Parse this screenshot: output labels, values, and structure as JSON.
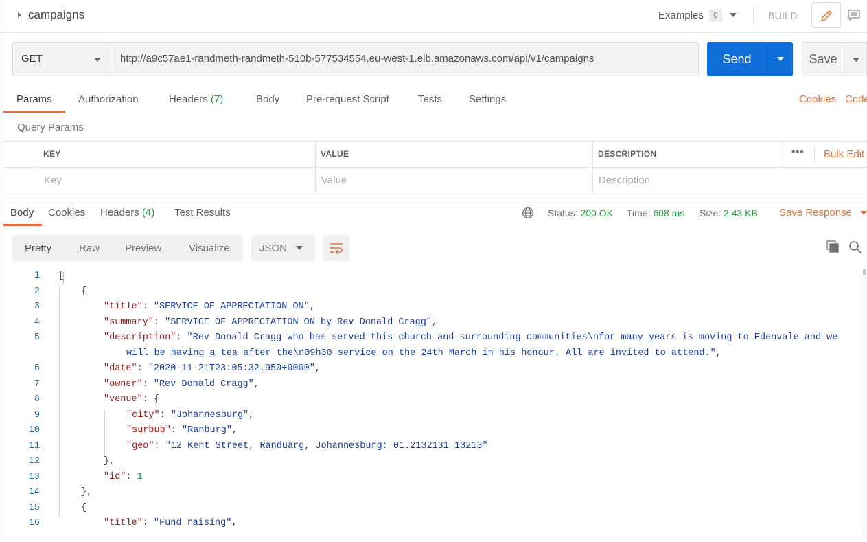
{
  "header": {
    "collection_name": "campaigns",
    "examples_label": "Examples",
    "examples_count": "0",
    "build_label": "BUILD",
    "icons": [
      "caret-right-icon",
      "chevron-down-icon",
      "pencil-icon",
      "comment-icon"
    ]
  },
  "request": {
    "method": "GET",
    "url": "http://a9c57ae1-randmeth-randmeth-510b-577534554.eu-west-1.elb.amazonaws.com/api/v1/campaigns",
    "send_label": "Send",
    "save_label": "Save"
  },
  "request_tabs": {
    "params": "Params",
    "authorization": "Authorization",
    "headers": "Headers",
    "headers_count": "(7)",
    "body": "Body",
    "prerequest": "Pre-request Script",
    "tests": "Tests",
    "settings": "Settings",
    "cookies": "Cookies",
    "code": "Code"
  },
  "query_params": {
    "label": "Query Params",
    "columns": [
      "KEY",
      "VALUE",
      "DESCRIPTION"
    ],
    "placeholders": [
      "Key",
      "Value",
      "Description"
    ],
    "more": "•••",
    "bulk_edit": "Bulk Edit"
  },
  "response": {
    "tabs": {
      "body": "Body",
      "cookies": "Cookies",
      "headers": "Headers",
      "headers_count": "(4)",
      "test_results": "Test Results"
    },
    "status_label": "Status:",
    "status_value": "200 OK",
    "time_label": "Time:",
    "time_value": "608 ms",
    "size_label": "Size:",
    "size_value": "2.43 KB",
    "save_response": "Save Response",
    "view_modes": [
      "Pretty",
      "Raw",
      "Preview",
      "Visualize"
    ],
    "format": "JSON",
    "colors": {
      "accent": "#f26b3a",
      "send": "#0f6fd9",
      "ok": "#2a9d44"
    }
  },
  "code_lines": [
    {
      "n": "1",
      "indent": 0,
      "t": [
        [
          "p",
          "["
        ]
      ]
    },
    {
      "n": "2",
      "indent": 1,
      "t": [
        [
          "p",
          "{"
        ]
      ]
    },
    {
      "n": "3",
      "indent": 2,
      "t": [
        [
          "k",
          "\"title\""
        ],
        [
          "p",
          ": "
        ],
        [
          "s",
          "\"SERVICE OF APPRECIATION ON\""
        ],
        [
          "p",
          ","
        ]
      ]
    },
    {
      "n": "4",
      "indent": 2,
      "t": [
        [
          "k",
          "\"summary\""
        ],
        [
          "p",
          ": "
        ],
        [
          "s",
          "\"SERVICE OF APPRECIATION ON by Rev Donald Cragg\""
        ],
        [
          "p",
          ","
        ]
      ]
    },
    {
      "n": "5",
      "indent": 2,
      "t": [
        [
          "k",
          "\"description\""
        ],
        [
          "p",
          ": "
        ],
        [
          "s",
          "\"Rev Donald Cragg who has served this church and surrounding communities\\nfor many years is moving to Edenvale and we"
        ]
      ]
    },
    {
      "n": "",
      "indent": 3,
      "t": [
        [
          "s",
          "will be having a tea after the\\n09h30 service on the 24th March in his honour. All are invited to attend.\""
        ],
        [
          "p",
          ","
        ]
      ]
    },
    {
      "n": "6",
      "indent": 2,
      "t": [
        [
          "k",
          "\"date\""
        ],
        [
          "p",
          ": "
        ],
        [
          "s",
          "\"2020-11-21T23:05:32.950+0000\""
        ],
        [
          "p",
          ","
        ]
      ]
    },
    {
      "n": "7",
      "indent": 2,
      "t": [
        [
          "k",
          "\"owner\""
        ],
        [
          "p",
          ": "
        ],
        [
          "s",
          "\"Rev Donald Cragg\""
        ],
        [
          "p",
          ","
        ]
      ]
    },
    {
      "n": "8",
      "indent": 2,
      "t": [
        [
          "k",
          "\"venue\""
        ],
        [
          "p",
          ": {"
        ]
      ]
    },
    {
      "n": "9",
      "indent": 3,
      "t": [
        [
          "k",
          "\"city\""
        ],
        [
          "p",
          ": "
        ],
        [
          "s",
          "\"Johannesburg\""
        ],
        [
          "p",
          ","
        ]
      ]
    },
    {
      "n": "10",
      "indent": 3,
      "t": [
        [
          "k",
          "\"surbub\""
        ],
        [
          "p",
          ": "
        ],
        [
          "s",
          "\"Ranburg\""
        ],
        [
          "p",
          ","
        ]
      ]
    },
    {
      "n": "11",
      "indent": 3,
      "t": [
        [
          "k",
          "\"geo\""
        ],
        [
          "p",
          ": "
        ],
        [
          "s",
          "\"12 Kent Street, Randuarg, Johannesburg: 01.2132131 13213\""
        ]
      ]
    },
    {
      "n": "12",
      "indent": 2,
      "t": [
        [
          "p",
          "},"
        ]
      ]
    },
    {
      "n": "13",
      "indent": 2,
      "t": [
        [
          "k",
          "\"id\""
        ],
        [
          "p",
          ": "
        ],
        [
          "n",
          "1"
        ]
      ]
    },
    {
      "n": "14",
      "indent": 1,
      "t": [
        [
          "p",
          "},"
        ]
      ]
    },
    {
      "n": "15",
      "indent": 1,
      "t": [
        [
          "p",
          "{"
        ]
      ]
    },
    {
      "n": "16",
      "indent": 2,
      "t": [
        [
          "k",
          "\"title\""
        ],
        [
          "p",
          ": "
        ],
        [
          "s",
          "\"Fund raising\""
        ],
        [
          "p",
          ","
        ]
      ]
    }
  ]
}
